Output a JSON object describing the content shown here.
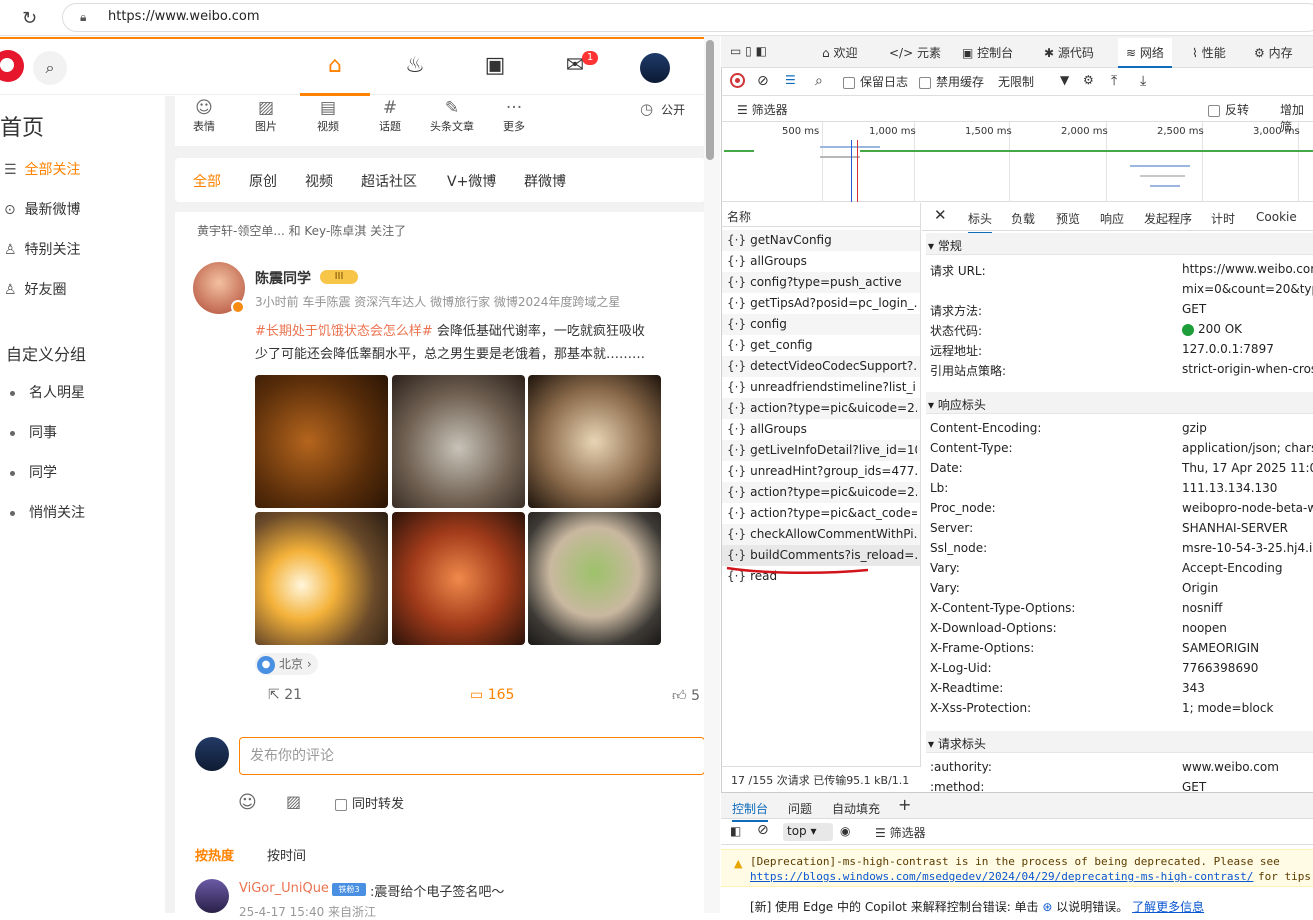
{
  "browser": {
    "url": "https://www.weibo.com"
  },
  "weibo": {
    "nav_badge": "1",
    "left_nav": {
      "title": "首页",
      "items": [
        "全部关注",
        "最新微博",
        "特别关注",
        "好友圈"
      ],
      "group_title": "自定义分组",
      "groups": [
        "名人明星",
        "同事",
        "同学",
        "悄悄关注"
      ]
    },
    "tools": [
      "表情",
      "图片",
      "视频",
      "话题",
      "头条文章",
      "更多"
    ],
    "public_label": "公开",
    "tabs": [
      "全部",
      "原创",
      "视频",
      "超话社区",
      "V+微博",
      "群微博"
    ],
    "post": {
      "follow_note": "黄宇轩-领空单... 和 Key-陈卓淇 关注了",
      "author": "陈震同学",
      "level_badge": "III",
      "meta": "3小时前  车手陈震 资深汽车达人 微博旅行家 微博2024年度跨域之星",
      "hashtag": "#长期处于饥饿状态会怎么样#",
      "text1": " 会降低基础代谢率，一吃就疯狂吸收",
      "text2": "少了可能还会降低睾酮水平，总之男生要是老饿着，那基本就………",
      "location": "北京",
      "reposts": "21",
      "comments": "165",
      "likes": "5"
    },
    "comment_box": {
      "placeholder": "发布你的评论",
      "repost_label": "同时转发"
    },
    "sort": {
      "hot": "按热度",
      "time": "按时间"
    },
    "comment": {
      "user": "ViGor_UniQue",
      "badge": "铁粉3",
      "text": ":震哥给个电子签名吧～",
      "time": "25-4-17 15:40 来自浙江"
    }
  },
  "devtools": {
    "tabs": [
      "欢迎",
      "元素",
      "控制台",
      "源代码",
      "网络",
      "性能",
      "内存"
    ],
    "toolbar": {
      "preserve_log": "保留日志",
      "disable_cache": "禁用缓存",
      "throttle": "无限制"
    },
    "filter": {
      "label": "筛选器",
      "invert": "反转",
      "more": "增加筛"
    },
    "ticks": [
      "500 ms",
      "1,000 ms",
      "1,500 ms",
      "2,000 ms",
      "2,500 ms",
      "3,000 ms"
    ],
    "list_header": "名称",
    "requests": [
      "getNavConfig",
      "allGroups",
      "config?type=push_active",
      "getTipsAd?posid=pc_login_...",
      "config",
      "get_config",
      "detectVideoCodecSupport?...",
      "unreadfriendstimeline?list_i...",
      "action?type=pic&uicode=2...",
      "allGroups",
      "getLiveInfoDetail?live_id=10...",
      "unreadHint?group_ids=477...",
      "action?type=pic&uicode=2...",
      "action?type=pic&act_code=...",
      "checkAllowCommentWithPi...",
      "buildComments?is_reload=...",
      "read"
    ],
    "list_footer": "17 /155 次请求   已传输95.1 kB/1.1",
    "detail_tabs": [
      "标头",
      "负载",
      "预览",
      "响应",
      "发起程序",
      "计时",
      "Cookie"
    ],
    "general": {
      "title": "常规",
      "rows": [
        {
          "k": "请求 URL:",
          "v": "https://www.weibo.com"
        },
        {
          "k": "",
          "v": "mix=0&count=20&typ"
        },
        {
          "k": "请求方法:",
          "v": "GET"
        },
        {
          "k": "状态代码:",
          "v": "200 OK"
        },
        {
          "k": "远程地址:",
          "v": "127.0.0.1:7897"
        },
        {
          "k": "引用站点策略:",
          "v": "strict-origin-when-cros"
        }
      ]
    },
    "response_headers": {
      "title": "响应标头",
      "rows": [
        {
          "k": "Content-Encoding:",
          "v": "gzip"
        },
        {
          "k": "Content-Type:",
          "v": "application/json; charse"
        },
        {
          "k": "Date:",
          "v": "Thu, 17 Apr 2025 11:00"
        },
        {
          "k": "Lb:",
          "v": "111.13.134.130"
        },
        {
          "k": "Proc_node:",
          "v": "weibopro-node-beta-w"
        },
        {
          "k": "Server:",
          "v": "SHANHAI-SERVER"
        },
        {
          "k": "Ssl_node:",
          "v": "msre-10-54-3-25.hj4.in"
        },
        {
          "k": "Vary:",
          "v": "Accept-Encoding"
        },
        {
          "k": "Vary:",
          "v": "Origin"
        },
        {
          "k": "X-Content-Type-Options:",
          "v": "nosniff"
        },
        {
          "k": "X-Download-Options:",
          "v": "noopen"
        },
        {
          "k": "X-Frame-Options:",
          "v": "SAMEORIGIN"
        },
        {
          "k": "X-Log-Uid:",
          "v": "7766398690"
        },
        {
          "k": "X-Readtime:",
          "v": "343"
        },
        {
          "k": "X-Xss-Protection:",
          "v": "1; mode=block"
        }
      ]
    },
    "request_headers": {
      "title": "请求标头",
      "rows": [
        {
          "k": ":authority:",
          "v": "www.weibo.com"
        },
        {
          "k": ":method:",
          "v": "GET"
        }
      ]
    },
    "drawer_tabs": [
      "控制台",
      "问题",
      "自动填充"
    ],
    "console": {
      "context": "top",
      "filter": "筛选器",
      "warning": "[Deprecation]-ms-high-contrast is in the process of being deprecated. Please see",
      "warning_link": "https://blogs.windows.com/msedgedev/2024/04/29/deprecating-ms-high-contrast/",
      "warning_suffix": "for tips",
      "info": "[新] 使用 Edge 中的 Copilot 来解释控制台错误: 单击",
      "info_suffix": "以说明错误。",
      "info_link": "了解更多信息"
    }
  }
}
